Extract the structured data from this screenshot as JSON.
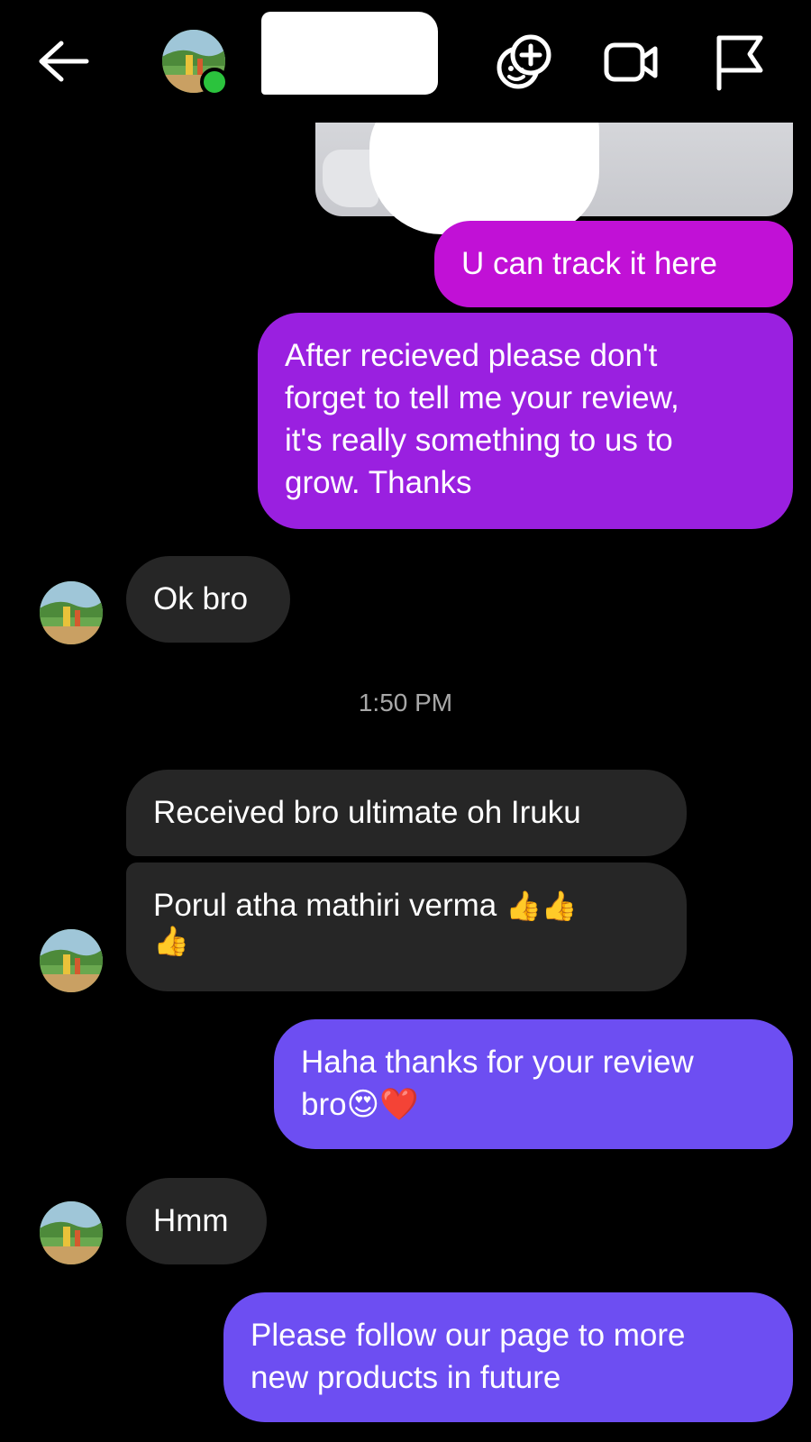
{
  "header": {
    "back_icon": "arrow-left-icon",
    "effects_icon": "effects-add-icon",
    "video_icon": "video-camera-icon",
    "report_icon": "flag-icon",
    "online": true
  },
  "messages": {
    "m1": "U can track it here",
    "m2": [
      "After recieved please don't",
      "forget to tell me your review,",
      "it's really something to us to",
      "grow. Thanks"
    ],
    "m3": "Ok bro",
    "time": "1:50 PM",
    "m4": "Received bro ultimate oh Iruku",
    "m5": [
      "Porul atha mathiri verma",
      "👍👍",
      "👍"
    ],
    "m6": [
      "Haha thanks for your review",
      "bro",
      "😍❤️"
    ],
    "m7": "Hmm",
    "m8": [
      "Please follow our page to more",
      "new products in future"
    ]
  },
  "colors": {
    "background": "#000000",
    "outgoing_magenta": "#c111d6",
    "outgoing_purple": "#9a20e0",
    "outgoing_violet": "#6d4ef2",
    "incoming": "#262626",
    "online": "#2bc33d"
  }
}
